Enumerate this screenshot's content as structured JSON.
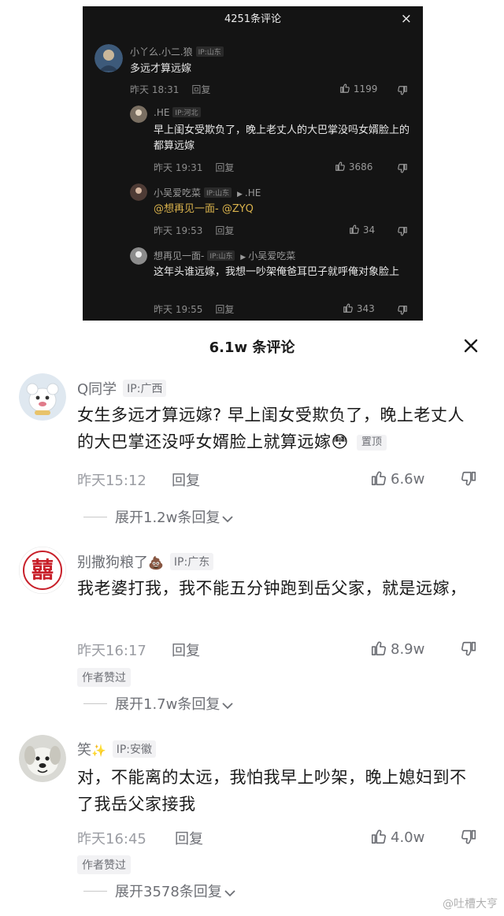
{
  "dark": {
    "header_title": "4251条评论",
    "close_glyph": "×",
    "comments": [
      {
        "name": "小丫么.小二.狼",
        "ip": "IP:山东",
        "text": "多远才算远嫁",
        "time": "昨天 18:31",
        "reply": "回复",
        "likes": "1199"
      },
      {
        "name": ".HE",
        "ip": "IP:河北",
        "text": "早上闺女受欺负了，晚上老丈人的大巴掌没吗女婿脸上的都算远嫁",
        "time": "昨天 19:31",
        "reply": "回复",
        "likes": "3686"
      },
      {
        "name": "小吴爱吃菜",
        "ip": "IP:山东",
        "reply_to": ".HE",
        "mention": "@想再见一面- @ZYQ",
        "time": "昨天 19:53",
        "reply": "回复",
        "likes": "34"
      },
      {
        "name": "想再见一面-",
        "ip": "IP:山东",
        "reply_to": "小吴爱吃菜",
        "text": "这年头谁远嫁，我想一吵架俺爸耳巴子就呼俺对象脸上",
        "time": "昨天 19:55",
        "reply": "回复",
        "likes": "343"
      }
    ]
  },
  "sheet": {
    "header_title": "6.1w 条评论",
    "comments": [
      {
        "name": "Q同学",
        "ip": "IP:广西",
        "text": "女生多远才算远嫁? 早上闺女受欺负了，晚上老丈人的大巴掌还没呼女婿脸上就算远嫁",
        "emoji": "😳",
        "pin": "置顶",
        "time": "昨天15:12",
        "reply": "回复",
        "likes": "6.6w",
        "expand": "展开1.2w条回复"
      },
      {
        "name": "别撒狗粮了",
        "name_emoji": "💩",
        "ip": "IP:广东",
        "text": "我老婆打我，我不能五分钟跑到岳父家，就是远嫁，",
        "time": "昨天16:17",
        "reply": "回复",
        "likes": "8.9w",
        "badge": "作者赞过",
        "expand": "展开1.7w条回复"
      },
      {
        "name": "笑",
        "name_emoji": "✨",
        "ip": "IP:安徽",
        "text": "对，不能离的太远，我怕我早上吵架，晚上媳妇到不了我岳父家接我",
        "time": "昨天16:45",
        "reply": "回复",
        "likes": "4.0w",
        "badge": "作者赞过",
        "expand": "展开3578条回复"
      }
    ],
    "wedding_glyph": "囍"
  },
  "watermark": "@吐槽大亨",
  "colors": {
    "dark_bg": "#141414",
    "sheet_bg": "#ffffff",
    "mention": "#d9b24c",
    "wedding_red": "#c8202a"
  }
}
